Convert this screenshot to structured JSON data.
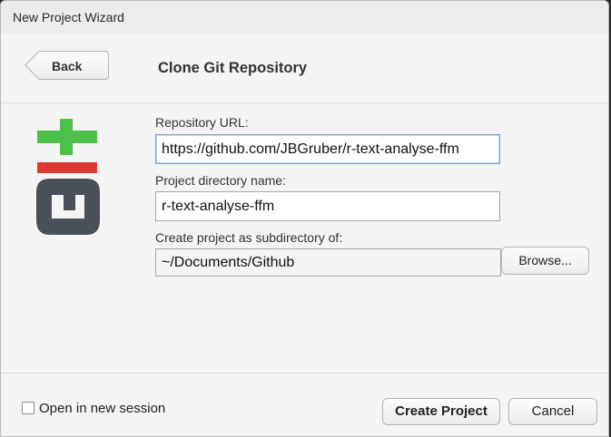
{
  "window": {
    "title": "New Project Wizard"
  },
  "header": {
    "back_label": "Back",
    "heading": "Clone Git Repository"
  },
  "logo": {
    "icon": "git-logo-icon",
    "colors": {
      "plus": "#4cc04a",
      "minus": "#dd3a36",
      "letters": "#4a5057"
    }
  },
  "form": {
    "repo_url": {
      "label": "Repository URL:",
      "value": "https://github.com/JBGruber/r-text-analyse-ffm"
    },
    "dir_name": {
      "label": "Project directory name:",
      "value": "r-text-analyse-ffm"
    },
    "subdir": {
      "label": "Create project as subdirectory of:",
      "value": "~/Documents/Github",
      "browse_label": "Browse..."
    }
  },
  "footer": {
    "new_session_label": "Open in new session",
    "new_session_checked": false,
    "create_label": "Create Project",
    "cancel_label": "Cancel"
  }
}
